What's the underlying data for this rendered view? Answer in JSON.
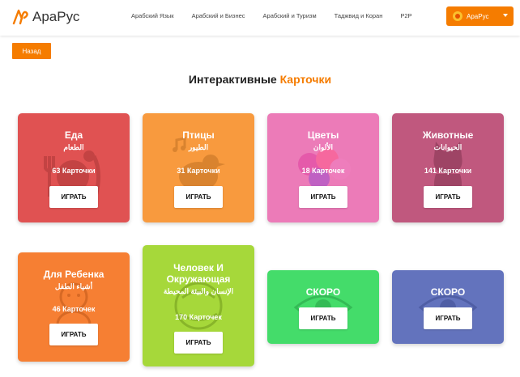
{
  "header": {
    "logo_text": "АраРус",
    "nav": [
      "Арабский Язык",
      "Арабский и Бизнес",
      "Арабский и Туризм",
      "Таджвид и Коран",
      "P2P"
    ],
    "account_label": "АраРус"
  },
  "back_label": "Назад",
  "title": {
    "main": "Интерактивные ",
    "highlight": "Карточки"
  },
  "colors": {
    "accent": "#f57c00"
  },
  "cards": [
    {
      "name": "Еда",
      "arabic": "الطعام",
      "count": "63 Карточки",
      "play": "ИГРАТЬ",
      "color": "#e05252",
      "icon": "food-icon"
    },
    {
      "name": "Птицы",
      "arabic": "الطيور",
      "count": "31 Карточки",
      "play": "ИГРАТЬ",
      "color": "#f89a3e",
      "icon": "bird-icon"
    },
    {
      "name": "Цветы",
      "arabic": "الألوان",
      "count": "18 Карточек",
      "play": "ИГРАТЬ",
      "color": "#ec7bb8",
      "icon": "flower-icon"
    },
    {
      "name": "Животные",
      "arabic": "الحيوانات",
      "count": "141 Карточки",
      "play": "ИГРАТЬ",
      "color": "#c0587e",
      "icon": "cat-icon"
    },
    {
      "name": "Для Ребенка",
      "arabic": "أشياء الطفل",
      "count": "46 Карточек",
      "play": "ИГРАТЬ",
      "color": "#f67f33",
      "icon": "baby-icon"
    },
    {
      "name": "Человек И Окружающая",
      "arabic": "الإنسان والبيئة المحيطة",
      "count": "170 Карточек",
      "play": "ИГРАТЬ",
      "color": "#a6d83a",
      "icon": "environment-icon"
    },
    {
      "name": "СКОРО",
      "arabic": "",
      "count": "",
      "play": "ИГРАТЬ",
      "color": "#44dc6a",
      "icon": "eye-icon"
    },
    {
      "name": "СКОРО",
      "arabic": "",
      "count": "",
      "play": "ИГРАТЬ",
      "color": "#6373bd",
      "icon": "eye-icon"
    }
  ]
}
